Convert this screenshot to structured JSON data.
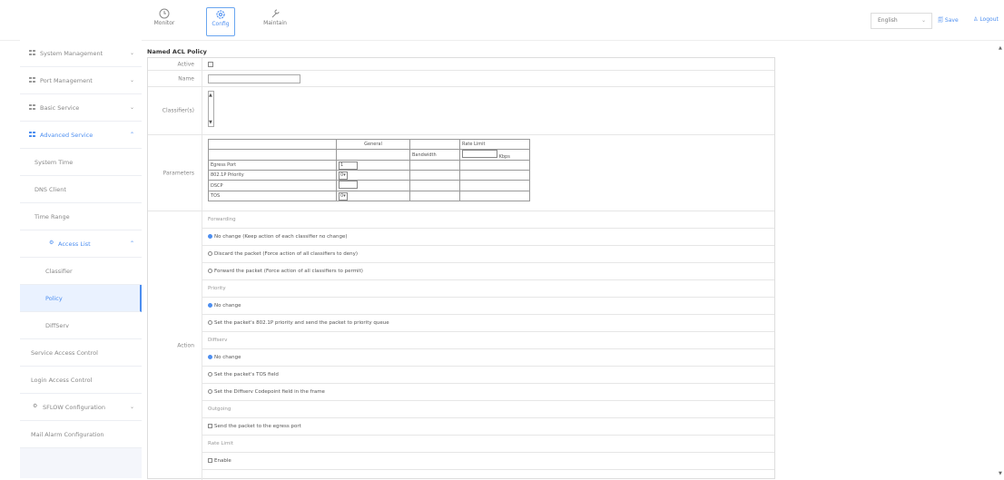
{
  "header": {
    "nav": [
      {
        "label": "Monitor"
      },
      {
        "label": "Config"
      },
      {
        "label": "Maintain"
      }
    ],
    "language": "English",
    "links": {
      "save": "Save",
      "logout": "Logout"
    }
  },
  "sidebar": {
    "items": [
      {
        "label": "System Management"
      },
      {
        "label": "Port Management"
      },
      {
        "label": "Basic Service"
      },
      {
        "label": "Advanced Service"
      },
      {
        "label": "System Time"
      },
      {
        "label": "DNS Client"
      },
      {
        "label": "Time Range"
      },
      {
        "label": "Access List"
      },
      {
        "label": "Classifier"
      },
      {
        "label": "Policy"
      },
      {
        "label": "DiffServ"
      },
      {
        "label": "Service Access Control"
      },
      {
        "label": "Login Access Control"
      },
      {
        "label": "SFLOW Configuration"
      },
      {
        "label": "Mail Alarm Configuration"
      }
    ]
  },
  "form": {
    "title": "Named ACL Policy",
    "labels": {
      "active": "Active",
      "name": "Name",
      "classifiers": "Classifier(s)",
      "parameters": "Parameters",
      "action": "Action"
    },
    "params": {
      "general": "General",
      "rate_limit": "Rate Limit",
      "bandwidth": "Bandwidth",
      "kbps": "Kbps",
      "egress_port": "Egress Port",
      "egress_port_value": "1",
      "p8021p": "802.1P Priority",
      "p8021p_value": "0",
      "dscp": "DSCP",
      "tos": "TOS",
      "tos_value": "0"
    },
    "action": {
      "forwarding": "Forwarding",
      "fwd_no_change": "No change (Keep action of each classifier no change)",
      "fwd_discard": "Discard the packet (Force action of all classifiers to deny)",
      "fwd_forward": "Forward the packet (Force action of all classifiers to permit)",
      "priority": "Priority",
      "pri_no_change": "No change",
      "pri_set": "Set the packet's 802.1P priority and send the packet to priority queue",
      "diffserv": "Diffserv",
      "ds_no_change": "No change",
      "ds_tos": "Set the packet's TOS field",
      "ds_dscp": "Set the Diffserv Codepoint field in the frame",
      "outgoing": "Outgoing",
      "out_send": "Send the packet to the egress port",
      "rate_limit": "Rate Limit",
      "rl_enable": "Enable"
    }
  }
}
